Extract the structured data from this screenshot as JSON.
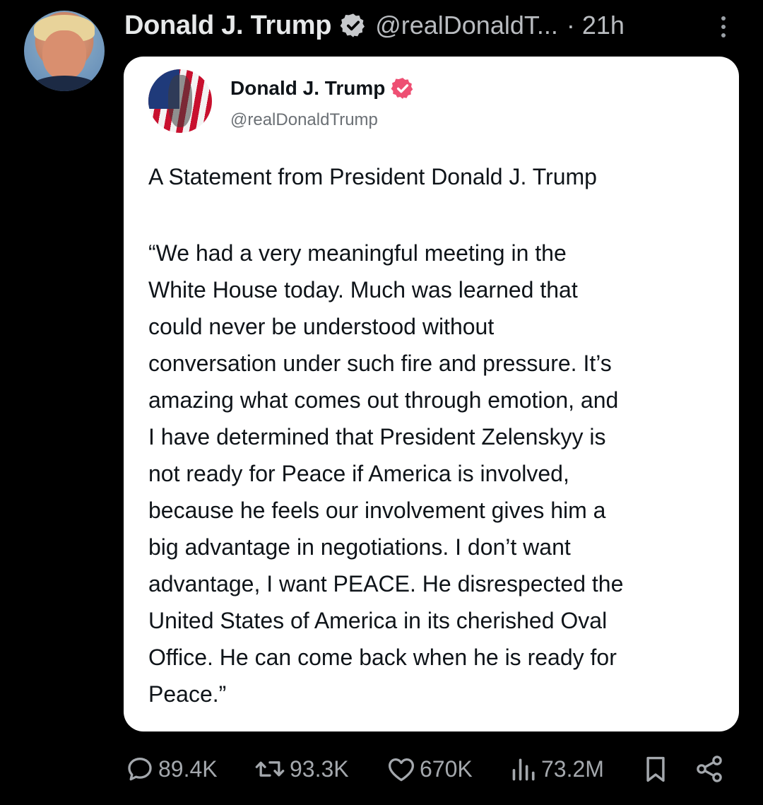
{
  "post": {
    "author_name": "Donald J. Trump",
    "author_handle": "@realDonaldT...",
    "timestamp": "· 21h",
    "more_icon": "more-vertical-icon"
  },
  "quoted_card": {
    "name": "Donald J. Trump",
    "handle": "@realDonaldTrump",
    "title": "A Statement from President Donald J. Trump",
    "body_lines": [
      "“We had a very meaningful meeting in the",
      "White House today. Much was learned that",
      "could never be understood without",
      "conversation under such fire and pressure. It’s",
      "amazing what comes out through emotion, and",
      "I have determined that President Zelenskyy is",
      "not ready for Peace if America is involved,",
      "because he feels our involvement gives him a",
      "big advantage in negotiations. I don’t want",
      "advantage, I want PEACE. He disrespected the",
      "United States of America in its cherished Oval",
      "Office. He can come back when he is ready for",
      "Peace.”"
    ]
  },
  "actions": {
    "replies": "89.4K",
    "reposts": "93.3K",
    "likes": "670K",
    "views": "73.2M"
  },
  "colors": {
    "background": "#000000",
    "card": "#ffffff",
    "verified_badge_gray": "#c7c9cc",
    "verified_badge_pink": "#ee4f73",
    "action_gray": "#a4a8ad"
  }
}
